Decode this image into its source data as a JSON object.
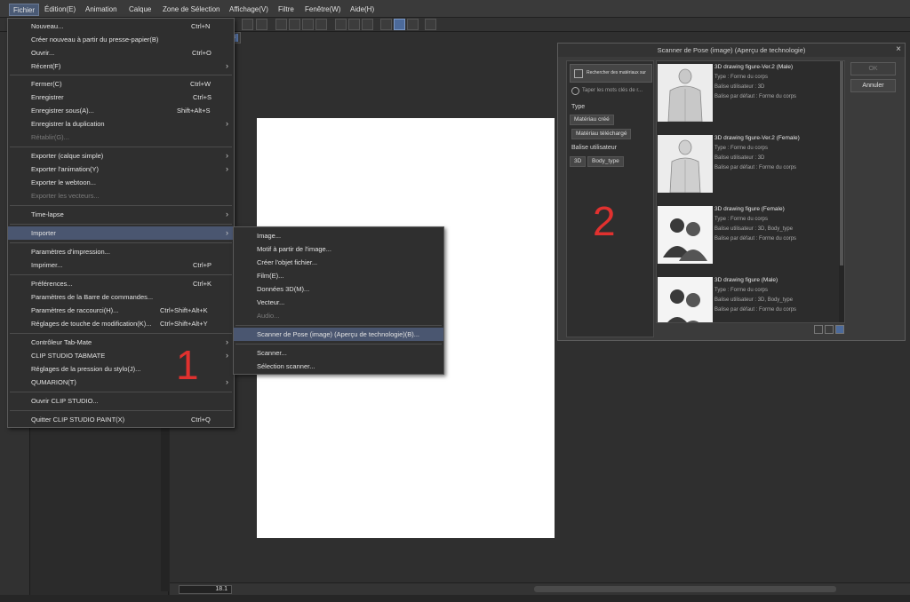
{
  "menubar": {
    "items": [
      "Fichier",
      "Édition(E)",
      "Animation",
      "Calque",
      "Zone de Sélection",
      "Affichage(V)",
      "Filtre",
      "Fenêtre(W)",
      "Aide(H)"
    ]
  },
  "canvas": {
    "zoom": "18.1"
  },
  "file_menu": {
    "items": [
      {
        "label": "Nouveau...",
        "shortcut": "Ctrl+N"
      },
      {
        "label": "Créer nouveau à partir du presse-papier(B)"
      },
      {
        "label": "Ouvrir...",
        "shortcut": "Ctrl+O"
      },
      {
        "label": "Récent(F)"
      },
      {
        "label": "Fermer(C)",
        "shortcut": "Ctrl+W"
      },
      {
        "label": "Enregistrer",
        "shortcut": "Ctrl+S"
      },
      {
        "label": "Enregistrer sous(A)...",
        "shortcut": "Shift+Alt+S"
      },
      {
        "label": "Enregistrer la duplication"
      },
      {
        "label": "Rétablir(G)..."
      },
      {
        "label": "Exporter (calque simple)"
      },
      {
        "label": "Exporter l'animation(Y)"
      },
      {
        "label": "Exporter le webtoon..."
      },
      {
        "label": "Exporter les vecteurs..."
      },
      {
        "label": "Time-lapse"
      },
      {
        "label": "Importer"
      },
      {
        "label": "Paramètres d'impression..."
      },
      {
        "label": "Imprimer...",
        "shortcut": "Ctrl+P"
      },
      {
        "label": "Préférences...",
        "shortcut": "Ctrl+K"
      },
      {
        "label": "Paramètres de la Barre de commandes..."
      },
      {
        "label": "Paramètres de raccourci(H)...",
        "shortcut": "Ctrl+Shift+Alt+K"
      },
      {
        "label": "Réglages de touche de modification(K)...",
        "shortcut": "Ctrl+Shift+Alt+Y"
      },
      {
        "label": "Contrôleur Tab-Mate"
      },
      {
        "label": "CLIP STUDIO TABMATE"
      },
      {
        "label": "Réglages de la pression du stylo(J)..."
      },
      {
        "label": "QUMARION(T)"
      },
      {
        "label": "Ouvrir CLIP STUDIO..."
      },
      {
        "label": "Quitter CLIP STUDIO PAINT(X)",
        "shortcut": "Ctrl+Q"
      }
    ]
  },
  "import_menu": {
    "items": [
      {
        "label": "Image..."
      },
      {
        "label": "Motif à partir de l'image..."
      },
      {
        "label": "Créer l'objet fichier..."
      },
      {
        "label": "Film(E)..."
      },
      {
        "label": "Données 3D(M)..."
      },
      {
        "label": "Vecteur..."
      },
      {
        "label": "Audio..."
      },
      {
        "label": "Scanner de Pose (image) (Aperçu de technologie)(B)..."
      },
      {
        "label": "Scanner..."
      },
      {
        "label": "Sélection scanner..."
      }
    ]
  },
  "dialog": {
    "title": "Scanner de Pose (image) (Aperçu de technologie)",
    "ok": "OK",
    "cancel": "Annuler",
    "search_button": "Rechercher des matériaux sur",
    "keyword_placeholder": "Taper les mots clés de r...",
    "type_label": "Type",
    "tag_created": "Matériau créé",
    "tag_downloaded": "Matériau téléchargé",
    "user_tag_label": "Balise utilisateur",
    "tag_3d": "3D",
    "tag_body": "Body_type",
    "materials": [
      {
        "name": "3D drawing figure-Ver.2 (Male)",
        "type": "Type : Forme du corps",
        "user_tag": "Balise utilisateur : 3D",
        "default_tag": "Balise par défaut : Forme du corps"
      },
      {
        "name": "3D drawing figure-Ver.2 (Female)",
        "type": "Type : Forme du corps",
        "user_tag": "Balise utilisateur : 3D",
        "default_tag": "Balise par défaut : Forme du corps"
      },
      {
        "name": "3D drawing figure (Female)",
        "type": "Type : Forme du corps",
        "user_tag": "Balise utilisateur : 3D, Body_type",
        "default_tag": "Balise par défaut : Forme du corps"
      },
      {
        "name": "3D drawing figure (Male)",
        "type": "Type : Forme du corps",
        "user_tag": "Balise utilisateur : 3D, Body_type",
        "default_tag": "Balise par défaut : Forme du corps"
      }
    ]
  },
  "annotations": {
    "one": "1",
    "two": "2"
  },
  "colors": {
    "accent": "#e0312f",
    "highlight": "#4a5670",
    "menubar_active": "#4a5a75"
  }
}
